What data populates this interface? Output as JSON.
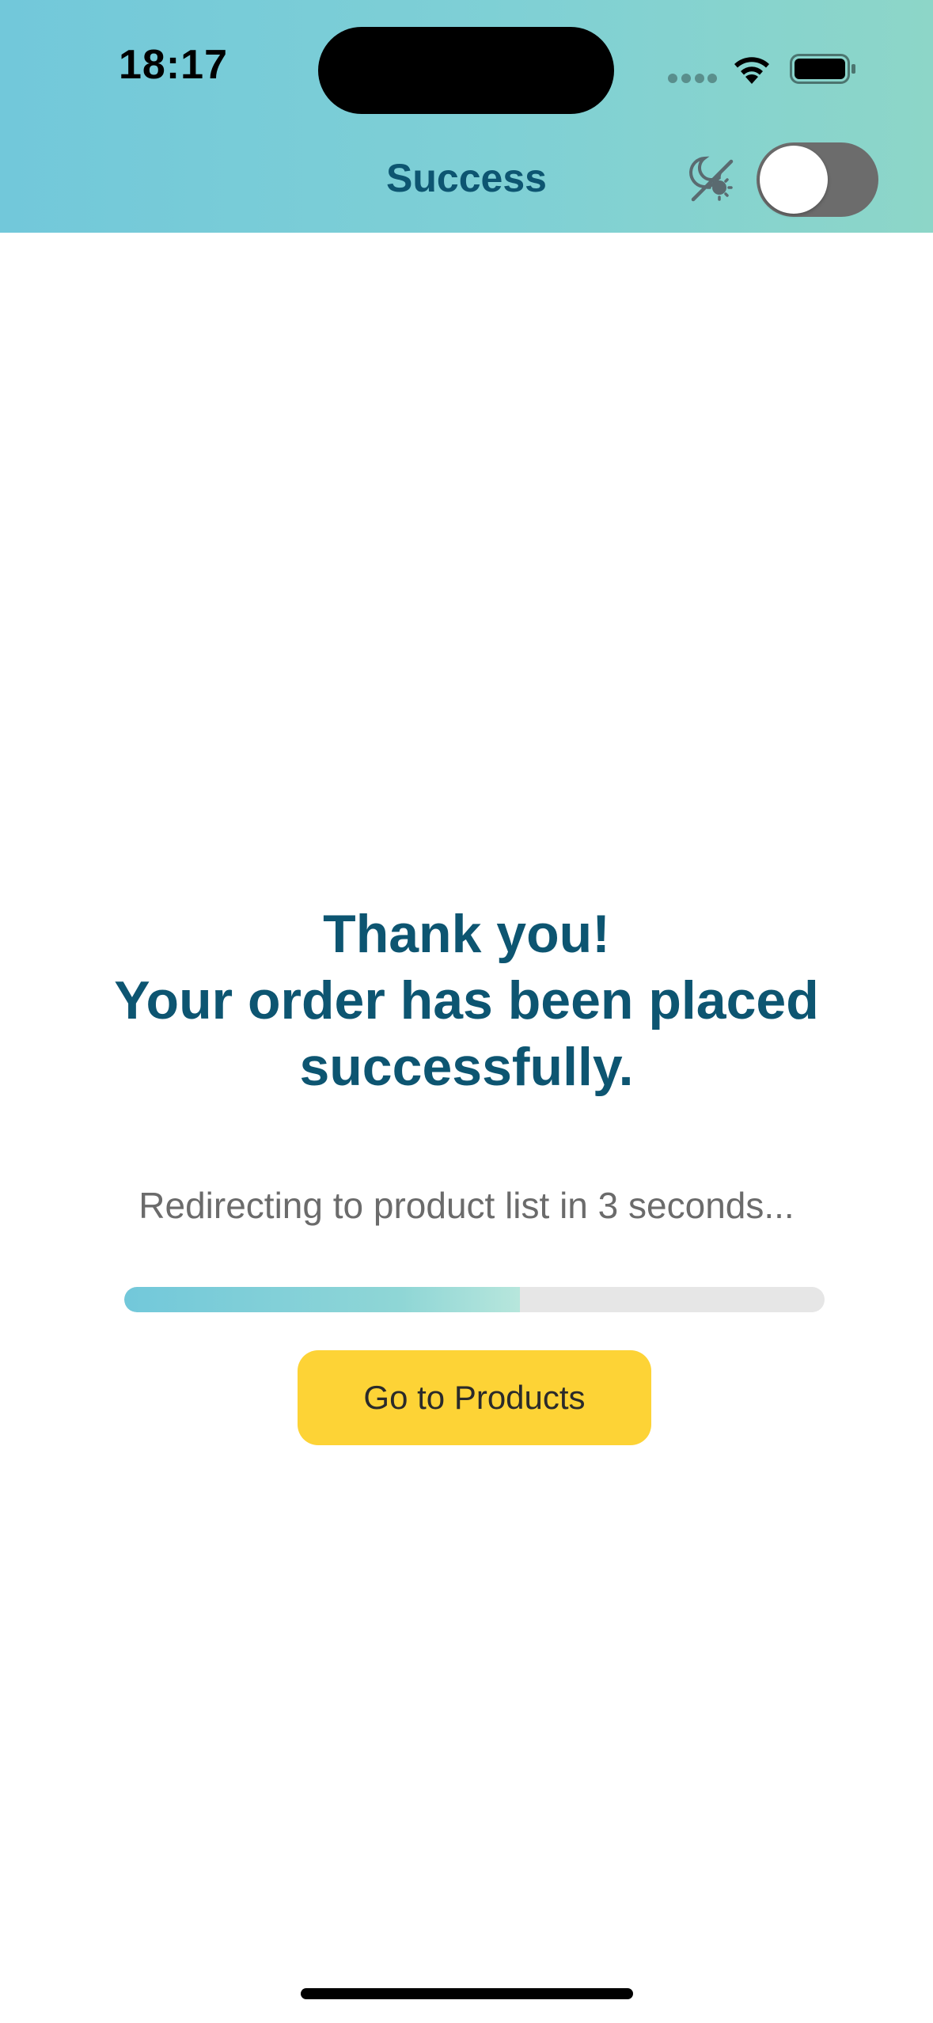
{
  "status_bar": {
    "time": "18:17",
    "icons": [
      "signal-icon",
      "wifi-icon",
      "battery-icon"
    ]
  },
  "nav": {
    "title": "Success",
    "theme_icon": "moon-sun-icon",
    "dark_mode_enabled": false
  },
  "main": {
    "headline_lines": [
      "Thank you!",
      "Your order has been placed",
      "successfully."
    ],
    "redirect_text": "Redirecting to product list in 3 seconds...",
    "progress_fraction": 0.565,
    "button_label": "Go to Products"
  },
  "colors": {
    "primary_text": "#0d5571",
    "accent_yellow": "#fdd336",
    "header_gradient_start": "#72c8da",
    "header_gradient_end": "#8dd6c8",
    "toggle_off": "#6c6c6c"
  }
}
